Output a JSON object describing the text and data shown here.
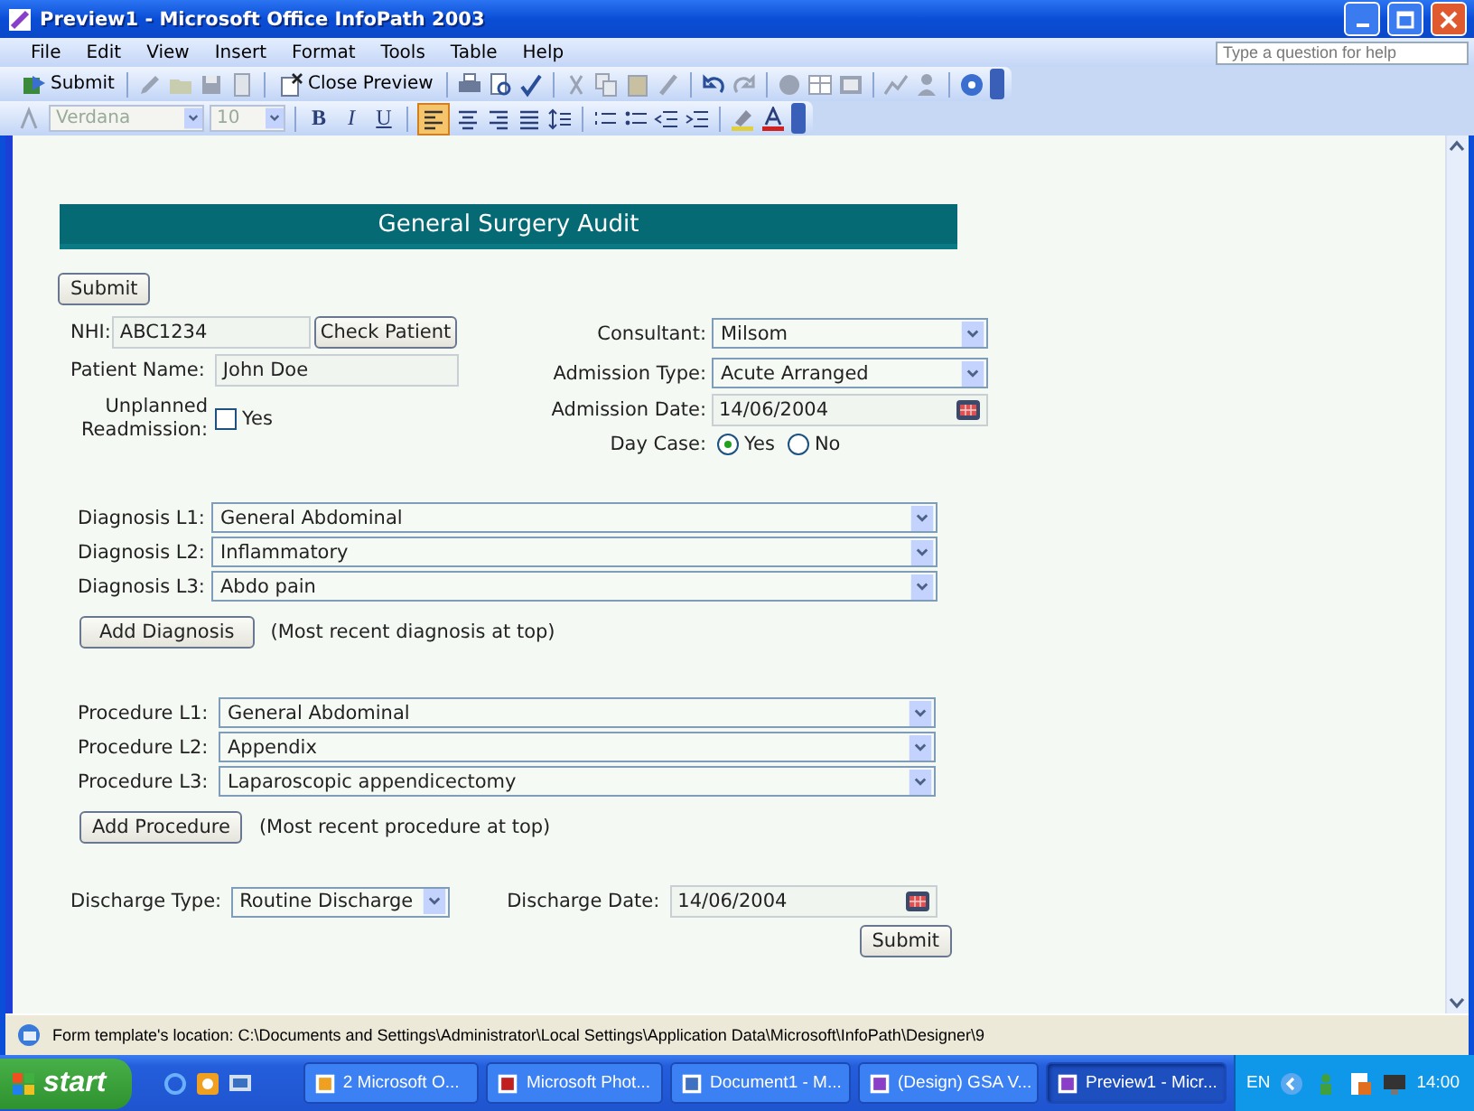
{
  "window": {
    "title": "Preview1 - Microsoft Office InfoPath 2003"
  },
  "menu": [
    "File",
    "Edit",
    "View",
    "Insert",
    "Format",
    "Tools",
    "Table",
    "Help"
  ],
  "help_box": {
    "placeholder": "Type a question for help"
  },
  "toolbar": {
    "submit": "Submit",
    "close_preview": "Close Preview"
  },
  "format_toolbar": {
    "font": "Verdana",
    "size": "10",
    "bold": "B",
    "italic": "I",
    "underline": "U"
  },
  "form": {
    "heading": "General Surgery Audit",
    "top_button": "Submit",
    "nhi": {
      "label": "NHI:",
      "value": "ABC1234",
      "button": "Check Patient"
    },
    "patient_name": {
      "label": "Patient Name:",
      "value": "John Doe"
    },
    "readmission": {
      "label": "Unplanned Readmission:",
      "option": "Yes",
      "checked": false
    },
    "consultant": {
      "label": "Consultant:",
      "value": "Milsom"
    },
    "admission_type": {
      "label": "Admission Type:",
      "value": "Acute Arranged"
    },
    "admission_date": {
      "label": "Admission Date:",
      "value": "14/06/2004"
    },
    "day_case": {
      "label": "Day Case:",
      "options": [
        {
          "label": "Yes",
          "selected": true
        },
        {
          "label": "No",
          "selected": false
        }
      ]
    },
    "diagnosis": [
      {
        "label": "Diagnosis L1:",
        "value": "General Abdominal"
      },
      {
        "label": "Diagnosis L2:",
        "value": "Inflammatory"
      },
      {
        "label": "Diagnosis L3:",
        "value": "Abdo pain"
      }
    ],
    "add_diagnosis": {
      "button": "Add Diagnosis",
      "note": "(Most recent diagnosis at top)"
    },
    "procedure": [
      {
        "label": "Procedure L1:",
        "value": "General Abdominal"
      },
      {
        "label": "Procedure L2:",
        "value": "Appendix"
      },
      {
        "label": "Procedure L3:",
        "value": "Laparoscopic appendicectomy"
      }
    ],
    "add_procedure": {
      "button": "Add Procedure",
      "note": "(Most recent procedure at top)"
    },
    "discharge_type": {
      "label": "Discharge Type:",
      "value": "Routine Discharge"
    },
    "discharge_date": {
      "label": "Discharge Date:",
      "value": "14/06/2004"
    },
    "bottom_button": "Submit"
  },
  "status_bar": {
    "text": "Form template's location: C:\\Documents and Settings\\Administrator\\Local Settings\\Application Data\\Microsoft\\InfoPath\\Designer\\9"
  },
  "taskbar": {
    "start": "start",
    "tasks": [
      {
        "label": "2 Microsoft O...",
        "selected": false
      },
      {
        "label": "Microsoft Phot...",
        "selected": false
      },
      {
        "label": "Document1 - M...",
        "selected": false
      },
      {
        "label": "(Design) GSA V...",
        "selected": false
      },
      {
        "label": "Preview1 - Micr...",
        "selected": true
      }
    ],
    "language": "EN",
    "clock": "14:00"
  }
}
